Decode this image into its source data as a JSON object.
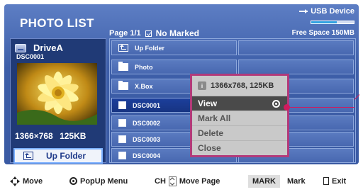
{
  "header": {
    "title": "PHOTO LIST",
    "page_info": "Page 1/1",
    "marked_status": "No Marked",
    "usb_label": "USB Device",
    "free_space": "Free Space 150MB",
    "free_space_fraction": 0.6
  },
  "preview": {
    "drive_name": "DriveA",
    "file_name": "DSC0001",
    "resolution": "1366×768",
    "size": "125KB",
    "up_folder_label": "Up Folder"
  },
  "grid": {
    "items": [
      {
        "label": "Up Folder",
        "type": "up"
      },
      {
        "label": "Photo",
        "type": "folder"
      },
      {
        "label": "X.Box",
        "type": "folder"
      },
      {
        "label": "DSC0001",
        "type": "file",
        "selected": true
      },
      {
        "label": "DSC0002",
        "type": "file"
      },
      {
        "label": "DSC0003",
        "type": "file"
      },
      {
        "label": "DSC0004",
        "type": "file"
      }
    ]
  },
  "popup": {
    "info": "1366x768, 125KB",
    "items": [
      {
        "label": "View",
        "active": true
      },
      {
        "label": "Mark All"
      },
      {
        "label": "Delete"
      },
      {
        "label": "Close"
      }
    ]
  },
  "footer": {
    "move": "Move",
    "popup_menu": "PopUp Menu",
    "ch": "CH",
    "move_page": "Move Page",
    "mark_key": "MARK",
    "mark": "Mark",
    "exit": "Exit"
  },
  "colors": {
    "background": "#3d5ea8",
    "selected_row": "#1c3f9c",
    "popup_border": "#b23a7a",
    "pointer": "#d01a5e"
  }
}
